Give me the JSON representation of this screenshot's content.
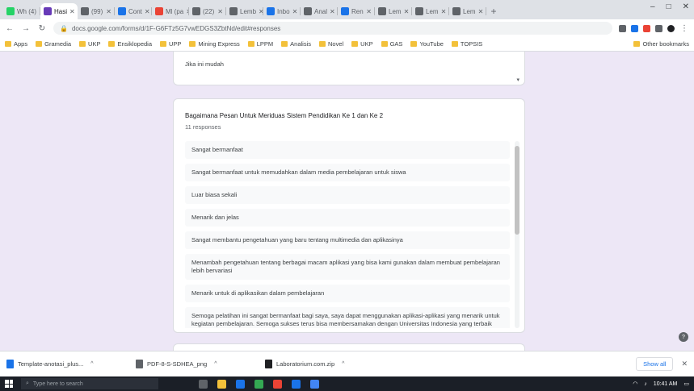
{
  "browser": {
    "tabs": [
      {
        "label": "Wh (4)",
        "color": "#25d366",
        "active": false
      },
      {
        "label": "Hasi",
        "color": "#673ab7",
        "active": true
      },
      {
        "label": "(99) ",
        "color": "#5f6368",
        "active": false
      },
      {
        "label": "Cont",
        "color": "#1a73e8",
        "active": false
      },
      {
        "label": "Ml (pa",
        "color": "#ea4335",
        "active": false
      },
      {
        "label": "(22) ",
        "color": "#5f6368",
        "active": false
      },
      {
        "label": "Lemb",
        "color": "#5f6368",
        "active": false
      },
      {
        "label": "Inbo",
        "color": "#1a73e8",
        "active": false
      },
      {
        "label": "Anal",
        "color": "#5f6368",
        "active": false
      },
      {
        "label": "Ren",
        "color": "#1a73e8",
        "active": false
      },
      {
        "label": "Lem",
        "color": "#5f6368",
        "active": false
      },
      {
        "label": "Lem",
        "color": "#5f6368",
        "active": false
      },
      {
        "label": "Lem",
        "color": "#5f6368",
        "active": false
      }
    ],
    "new_tab": "+",
    "window_controls": [
      "–",
      "□",
      "✕"
    ],
    "nav": {
      "back": "←",
      "forward": "→",
      "reload": "↻"
    },
    "url": "docs.google.com/forms/d/1F-G6FTz5G7vwEDGS3ZbtNd/edit#responses",
    "bookmarks": [
      "Apps",
      "Gramedia",
      "UKP",
      "Ensiklopedia",
      "UPP",
      "Mining Express",
      "LPPM",
      "Analisis",
      "Novel",
      "UKP",
      "GAS",
      "YouTube",
      "TOPSIS"
    ],
    "bookmarks_right": "Other bookmarks"
  },
  "form": {
    "prev_response": "Jika ini mudah",
    "question": "Bagaimana Pesan Untuk Meriduas Sistem Pendidikan Ke 1 dan Ke 2",
    "response_count": "11 responses",
    "responses": [
      "Sangat bermanfaat",
      "Sangat bermanfaat untuk memudahkan dalam media pembelajaran untuk siswa",
      "Luar biasa sekali",
      "Menarik dan jelas",
      "Sangat membantu pengetahuan yang baru tentang multimedia dan aplikasinya",
      "Menambah pengetahuan tentang berbagai macam aplikasi yang bisa kami gunakan dalam membuat pembelajaran lebih bervariasi",
      "Menarik untuk di aplikasikan dalam pembelajaran",
      "Semoga pelatihan ini sangat bermanfaat bagi saya, saya dapat menggunakan aplikasi-aplikasi yang menarik untuk kegiatan pembelajaran. Semoga sukses terus bisa membersamakan dengan Universitas Indonesia yang terbaik"
    ]
  },
  "downloads": {
    "items": [
      {
        "name": "Template-anotasi_plus...",
        "color": "#1a73e8"
      },
      {
        "name": "PDF-8-S-SDHEA_png",
        "color": "#5f6368"
      },
      {
        "name": "Laboratorium.com.zip",
        "color": "#202124"
      }
    ],
    "show_all": "Show all",
    "close": "✕"
  },
  "taskbar": {
    "search_placeholder": "Type here to search",
    "time": "10:41 AM",
    "apps": [
      "#5f6368",
      "#f3c13a",
      "#1a73e8",
      "#34a853",
      "#ea4335",
      "#1a73e8",
      "#4285f4"
    ]
  }
}
